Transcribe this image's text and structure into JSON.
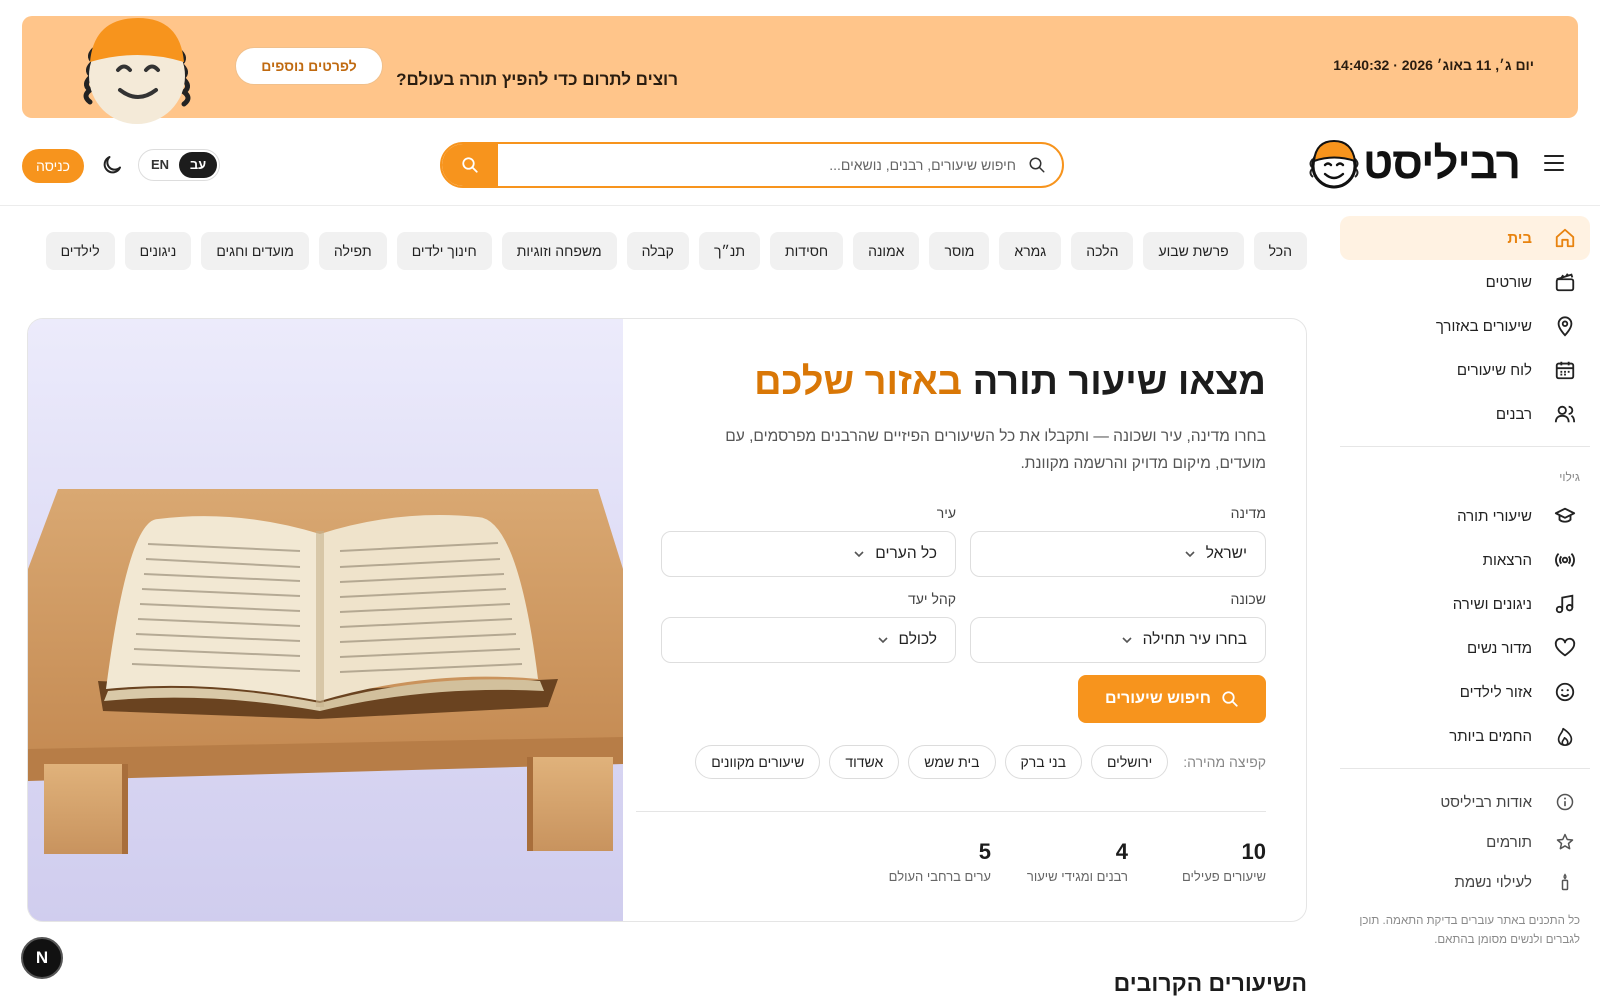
{
  "banner": {
    "datetime": "יום ג׳, 11 באוג׳ 2026 · 14:40:32",
    "message": "רוצים לתרום כדי להפיץ תורה בעולם?",
    "details_button": "לפרטים נוספים"
  },
  "header": {
    "logo_text": "רביליסט",
    "search_placeholder": "חיפוש שיעורים, רבנים, נושאים...",
    "lang_he": "עב",
    "lang_en": "EN",
    "login_label": "כניסה"
  },
  "sidebar": {
    "main_items": [
      {
        "label": "בית",
        "icon": "home-icon"
      },
      {
        "label": "שורטים",
        "icon": "clapperboard-icon"
      },
      {
        "label": "שיעורים באזורך",
        "icon": "map-pin-icon"
      },
      {
        "label": "לוח שיעורים",
        "icon": "calendar-icon"
      },
      {
        "label": "רבנים",
        "icon": "users-icon"
      }
    ],
    "discover_heading": "גילוי",
    "discover_items": [
      {
        "label": "שיעורי תורה",
        "icon": "graduation-cap-icon"
      },
      {
        "label": "הרצאות",
        "icon": "broadcast-icon"
      },
      {
        "label": "ניגונים ושירה",
        "icon": "music-icon"
      },
      {
        "label": "מדור נשים",
        "icon": "heart-icon"
      },
      {
        "label": "אזור לילדים",
        "icon": "smiley-icon"
      },
      {
        "label": "החמים ביותר",
        "icon": "flame-icon"
      }
    ],
    "footer_items": [
      {
        "label": "אודות רביליסט",
        "icon": "info-icon"
      },
      {
        "label": "תורמים",
        "icon": "star-icon"
      },
      {
        "label": "לעילוי נשמת",
        "icon": "candle-icon"
      }
    ],
    "note": "כל התכנים באתר עוברים בדיקת התאמה. תוכן לגברים ולנשים מסומן בהתאם."
  },
  "categories": [
    "הכל",
    "פרשת שבוע",
    "הלכה",
    "גמרא",
    "מוסר",
    "אמונה",
    "חסידות",
    "תנ״ך",
    "קבלה",
    "משפחה וזוגיות",
    "חינוך ילדים",
    "תפילה",
    "מועדים וחגים",
    "ניגונים",
    "לילדים"
  ],
  "hero": {
    "title_main": "מצאו שיעור תורה",
    "title_accent": "באזור שלכם",
    "description": "בחרו מדינה, עיר ושכונה — ותקבלו את כל השיעורים הפיזיים שהרבנים מפרסמים, עם מועדים, מיקום מדויק והרשמה מקוונת.",
    "country_label": "מדינה",
    "country_value": "ישראל",
    "city_label": "עיר",
    "city_value": "כל הערים",
    "neighborhood_label": "שכונה",
    "neighborhood_value": "בחרו עיר תחילה",
    "audience_label": "קהל יעד",
    "audience_value": "לכולם",
    "search_button": "חיפוש שיעורים",
    "quick_label": "קפיצה מהירה:",
    "quick_chips": [
      "ירושלים",
      "בני ברק",
      "בית שמש",
      "אשדוד",
      "שיעורים מקוונים"
    ],
    "stats": [
      {
        "value": "10",
        "label": "שיעורים פעילים"
      },
      {
        "value": "4",
        "label": "רבנים ומגידי שיעור"
      },
      {
        "value": "5",
        "label": "ערים ברחבי העולם"
      }
    ]
  },
  "upcoming_title": "השיעורים הקרובים",
  "dev_badge": "N",
  "colors": {
    "accent": "#f7941d",
    "banner": "#ffc58a",
    "accent_text": "#d97706"
  }
}
